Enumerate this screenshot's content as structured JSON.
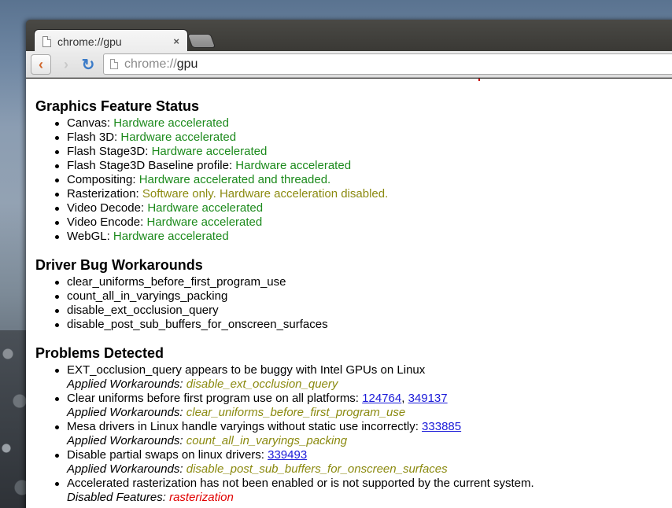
{
  "tab": {
    "title": "chrome://gpu",
    "close": "×"
  },
  "omnibox": {
    "scheme": "chrome://",
    "host": "gpu"
  },
  "nav": {
    "back": "‹",
    "forward": "›",
    "reload": "↻"
  },
  "sections": {
    "feature_status": {
      "title": "Graphics Feature Status",
      "items": [
        {
          "label": "Canvas: ",
          "value": "Hardware accelerated",
          "status": "green"
        },
        {
          "label": "Flash 3D: ",
          "value": "Hardware accelerated",
          "status": "green"
        },
        {
          "label": "Flash Stage3D: ",
          "value": "Hardware accelerated",
          "status": "green"
        },
        {
          "label": "Flash Stage3D Baseline profile: ",
          "value": "Hardware accelerated",
          "status": "green"
        },
        {
          "label": "Compositing: ",
          "value": "Hardware accelerated and threaded.",
          "status": "green"
        },
        {
          "label": "Rasterization: ",
          "value": "Software only. Hardware acceleration disabled.",
          "status": "olive"
        },
        {
          "label": "Video Decode: ",
          "value": "Hardware accelerated",
          "status": "green"
        },
        {
          "label": "Video Encode: ",
          "value": "Hardware accelerated",
          "status": "green"
        },
        {
          "label": "WebGL: ",
          "value": "Hardware accelerated",
          "status": "green"
        }
      ]
    },
    "workarounds": {
      "title": "Driver Bug Workarounds",
      "items": [
        "clear_uniforms_before_first_program_use",
        "count_all_in_varyings_packing",
        "disable_ext_occlusion_query",
        "disable_post_sub_buffers_for_onscreen_surfaces"
      ]
    },
    "problems": {
      "title": "Problems Detected",
      "applied_label": "Applied Workarounds: ",
      "disabled_label": "Disabled Features: ",
      "items": [
        {
          "text": "EXT_occlusion_query appears to be buggy with Intel GPUs on Linux",
          "workaround": "disable_ext_occlusion_query"
        },
        {
          "text": "Clear uniforms before first program use on all platforms: ",
          "link1": "124764",
          "sep": ", ",
          "link2": "349137",
          "workaround": "clear_uniforms_before_first_program_use"
        },
        {
          "text": "Mesa drivers in Linux handle varyings without static use incorrectly: ",
          "link1": "333885",
          "workaround": "count_all_in_varyings_packing"
        },
        {
          "text": "Disable partial swaps on linux drivers: ",
          "link1": "339493",
          "workaround": "disable_post_sub_buffers_for_onscreen_surfaces"
        },
        {
          "text": "Accelerated rasterization has not been enabled or is not supported by the current system.",
          "disabled": "rasterization"
        }
      ]
    }
  }
}
